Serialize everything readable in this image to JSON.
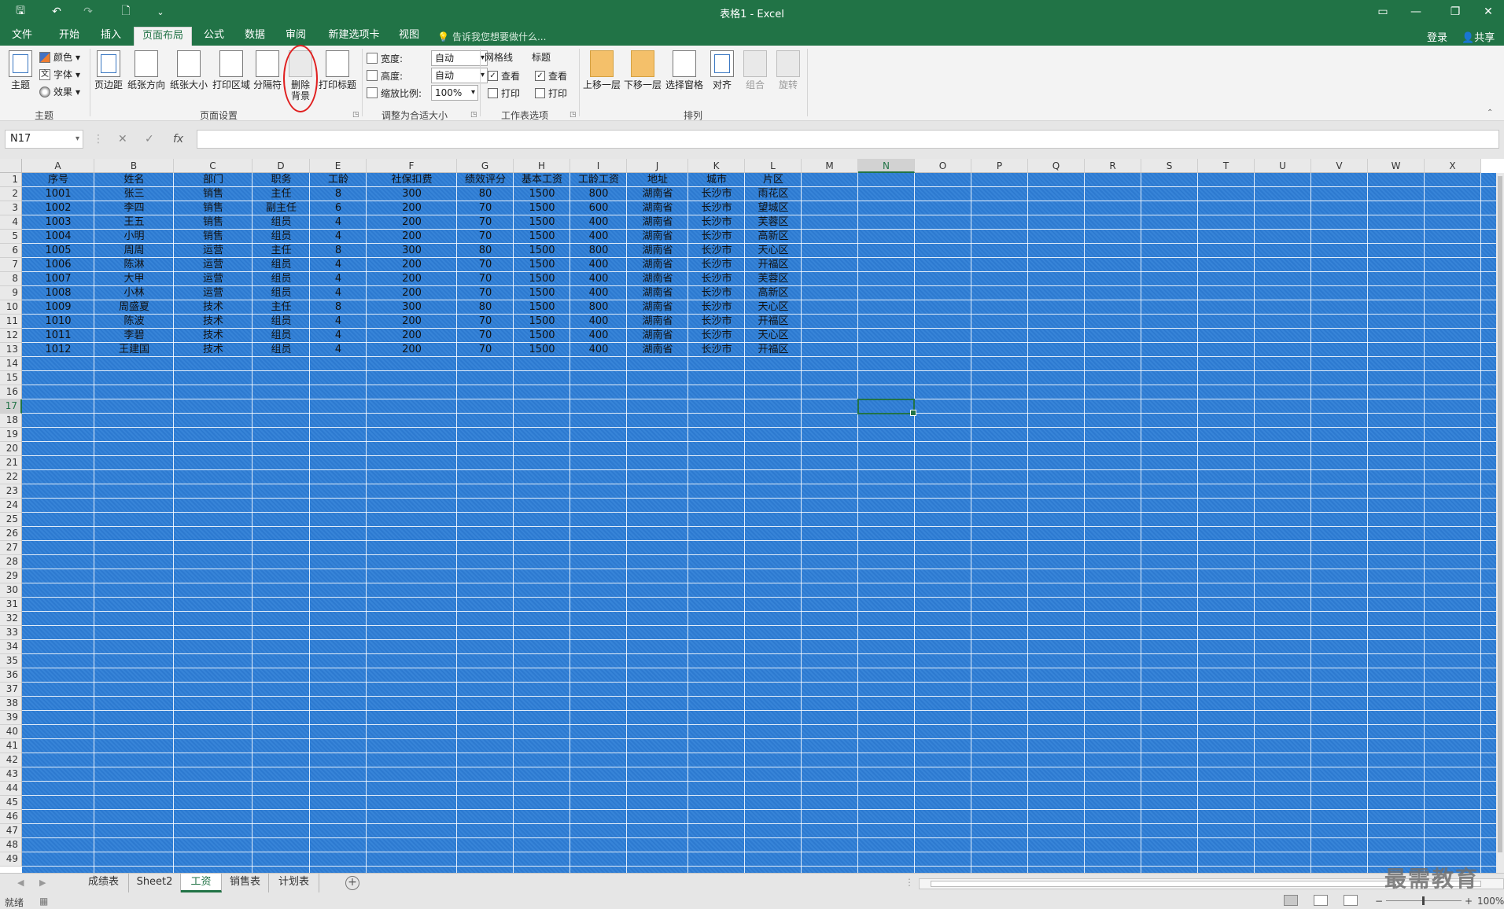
{
  "window": {
    "title": "表格1 - Excel",
    "qat": [
      {
        "name": "save-icon",
        "glyph": "🖫"
      },
      {
        "name": "undo-icon",
        "glyph": "↶"
      },
      {
        "name": "redo-icon",
        "glyph": "↷"
      },
      {
        "name": "new-file-icon",
        "glyph": "🗋"
      },
      {
        "name": "customize-qat-icon",
        "glyph": "⌄"
      }
    ],
    "controls": {
      "ribbon_display": "▭",
      "minimize": "—",
      "restore": "❐",
      "close": "✕"
    }
  },
  "tabs": [
    "文件",
    "开始",
    "插入",
    "页面布局",
    "公式",
    "数据",
    "审阅",
    "新建选项卡",
    "视图"
  ],
  "active_tab": "页面布局",
  "tell_me": "告诉我您想要做什么...",
  "account": {
    "login": "登录",
    "share": "共享"
  },
  "ribbon": {
    "theme": {
      "button": "主题",
      "colors": "颜色",
      "fonts": "字体",
      "effects": "效果",
      "group": "主题"
    },
    "page_setup": {
      "margins": "页边距",
      "orientation": "纸张方向",
      "size": "纸张大小",
      "print_area": "打印区域",
      "breaks": "分隔符",
      "delete_bg_1": "删除",
      "delete_bg_2": "背景",
      "print_titles": "打印标题",
      "group": "页面设置"
    },
    "scale": {
      "width_label": "宽度:",
      "width_value": "自动",
      "height_label": "高度:",
      "height_value": "自动",
      "scale_label": "缩放比例:",
      "scale_value": "100%",
      "group": "调整为合适大小"
    },
    "sheet_options": {
      "gridlines": "网格线",
      "headings": "标题",
      "view": "查看",
      "print": "打印",
      "group": "工作表选项"
    },
    "arrange": {
      "bring_forward": "上移一层",
      "send_backward": "下移一层",
      "selection_pane": "选择窗格",
      "align": "对齐",
      "group_btn": "组合",
      "rotate": "旋转",
      "group": "排列"
    }
  },
  "formula_bar": {
    "name_box": "N17",
    "cancel": "✕",
    "enter": "✓",
    "fx": "fx",
    "value": ""
  },
  "sheet": {
    "columns": [
      "A",
      "B",
      "C",
      "D",
      "E",
      "F",
      "G",
      "H",
      "I",
      "J",
      "K",
      "L",
      "M",
      "N",
      "O",
      "P",
      "Q",
      "R",
      "S",
      "T",
      "U",
      "V",
      "W",
      "X"
    ],
    "rows": [
      "1",
      "2",
      "3",
      "4",
      "5",
      "6",
      "7",
      "8",
      "9",
      "10",
      "11",
      "12",
      "13",
      "14",
      "15",
      "16",
      "17",
      "18",
      "19",
      "20",
      "21",
      "22",
      "23",
      "24",
      "25",
      "26",
      "27",
      "28",
      "29",
      "30",
      "31",
      "32",
      "33",
      "34",
      "35",
      "36",
      "37",
      "38",
      "39",
      "40",
      "41",
      "42",
      "43",
      "44",
      "45",
      "46",
      "47",
      "48",
      "49"
    ],
    "selected_col": "N",
    "selected_row": "17",
    "header": [
      "序号",
      "姓名",
      "部门",
      "职务",
      "工龄",
      "社保扣费",
      "绩效评分",
      "基本工资",
      "工龄工资",
      "地址",
      "城市",
      "片区"
    ],
    "data": [
      [
        "1001",
        "张三",
        "销售",
        "主任",
        "8",
        "300",
        "80",
        "1500",
        "800",
        "湖南省",
        "长沙市",
        "雨花区"
      ],
      [
        "1002",
        "李四",
        "销售",
        "副主任",
        "6",
        "200",
        "70",
        "1500",
        "600",
        "湖南省",
        "长沙市",
        "望城区"
      ],
      [
        "1003",
        "王五",
        "销售",
        "组员",
        "4",
        "200",
        "70",
        "1500",
        "400",
        "湖南省",
        "长沙市",
        "芙蓉区"
      ],
      [
        "1004",
        "小明",
        "销售",
        "组员",
        "4",
        "200",
        "70",
        "1500",
        "400",
        "湖南省",
        "长沙市",
        "高新区"
      ],
      [
        "1005",
        "周周",
        "运营",
        "主任",
        "8",
        "300",
        "80",
        "1500",
        "800",
        "湖南省",
        "长沙市",
        "天心区"
      ],
      [
        "1006",
        "陈淋",
        "运营",
        "组员",
        "4",
        "200",
        "70",
        "1500",
        "400",
        "湖南省",
        "长沙市",
        "开福区"
      ],
      [
        "1007",
        "大甲",
        "运营",
        "组员",
        "4",
        "200",
        "70",
        "1500",
        "400",
        "湖南省",
        "长沙市",
        "芙蓉区"
      ],
      [
        "1008",
        "小林",
        "运营",
        "组员",
        "4",
        "200",
        "70",
        "1500",
        "400",
        "湖南省",
        "长沙市",
        "高新区"
      ],
      [
        "1009",
        "周盛夏",
        "技术",
        "主任",
        "8",
        "300",
        "80",
        "1500",
        "800",
        "湖南省",
        "长沙市",
        "天心区"
      ],
      [
        "1010",
        "陈波",
        "技术",
        "组员",
        "4",
        "200",
        "70",
        "1500",
        "400",
        "湖南省",
        "长沙市",
        "开福区"
      ],
      [
        "1011",
        "李碧",
        "技术",
        "组员",
        "4",
        "200",
        "70",
        "1500",
        "400",
        "湖南省",
        "长沙市",
        "天心区"
      ],
      [
        "1012",
        "王建国",
        "技术",
        "组员",
        "4",
        "200",
        "70",
        "1500",
        "400",
        "湖南省",
        "长沙市",
        "开福区"
      ]
    ]
  },
  "sheet_tabs": [
    "成绩表",
    "Sheet2",
    "工资",
    "销售表",
    "计划表"
  ],
  "active_sheet": "工资",
  "status": {
    "ready": "就绪",
    "zoom": "100%"
  },
  "watermark": "最需教育",
  "colors": {
    "excel_green": "#217346",
    "sheet_background": "#2f7fd6",
    "highlight": "#e02020"
  }
}
